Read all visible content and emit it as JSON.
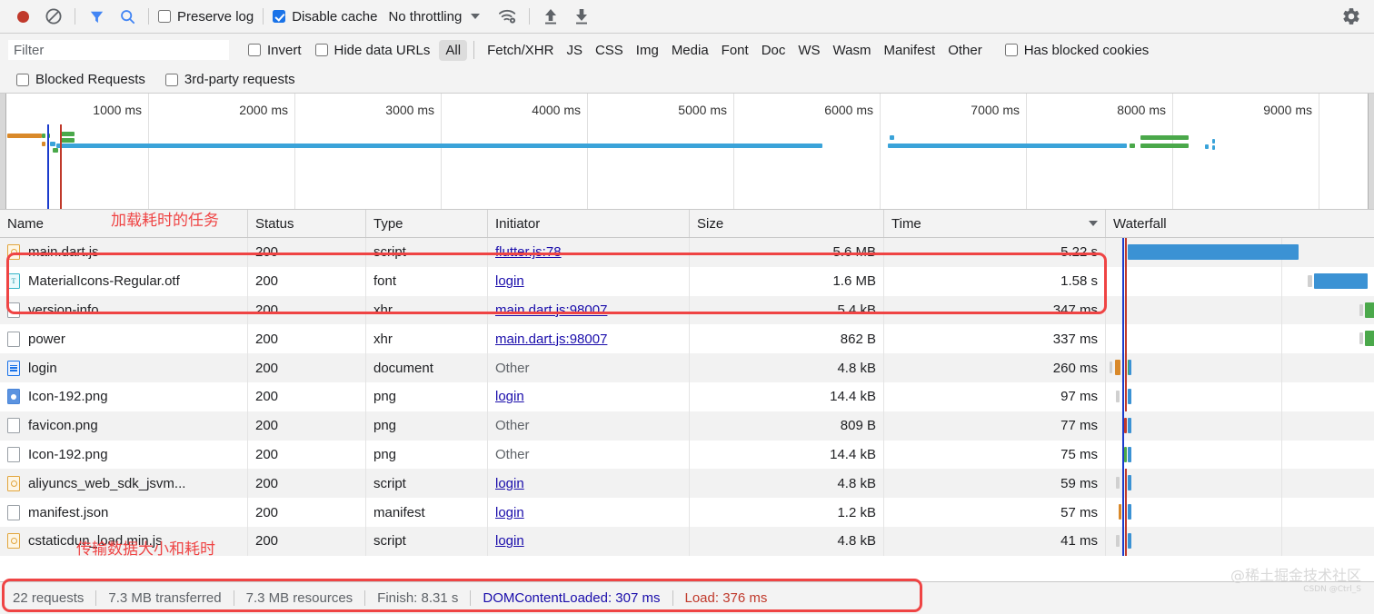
{
  "toolbar": {
    "record_button": "record",
    "clear_button": "clear",
    "filter_icon": "filter-funnel-icon",
    "search_icon": "search-icon",
    "preserve_log_label": "Preserve log",
    "preserve_log_checked": false,
    "disable_cache_label": "Disable cache",
    "disable_cache_checked": true,
    "throttling_value": "No throttling",
    "network_conditions_icon": "wifi-settings-icon",
    "import_har_icon": "upload-arrow-icon",
    "export_har_icon": "download-arrow-icon",
    "settings_icon": "gear-icon"
  },
  "filterbar": {
    "filter_placeholder": "Filter",
    "filter_value": "",
    "invert_label": "Invert",
    "invert_checked": false,
    "hide_data_urls_label": "Hide data URLs",
    "hide_data_urls_checked": false,
    "types": [
      "All",
      "Fetch/XHR",
      "JS",
      "CSS",
      "Img",
      "Media",
      "Font",
      "Doc",
      "WS",
      "Wasm",
      "Manifest",
      "Other"
    ],
    "selected_type": "All",
    "has_blocked_cookies_label": "Has blocked cookies",
    "has_blocked_cookies_checked": false,
    "blocked_requests_label": "Blocked Requests",
    "blocked_requests_checked": false,
    "third_party_label": "3rd-party requests",
    "third_party_checked": false
  },
  "overview": {
    "ticks": [
      "1000 ms",
      "2000 ms",
      "3000 ms",
      "4000 ms",
      "5000 ms",
      "6000 ms",
      "7000 ms",
      "8000 ms",
      "9000 ms"
    ],
    "dcl_marker_color": "#1a3bcc",
    "load_marker_color": "#c0392b"
  },
  "table": {
    "columns": [
      "Name",
      "Status",
      "Type",
      "Initiator",
      "Size",
      "Time",
      "Waterfall"
    ],
    "sorted_column": "Time",
    "sort_direction": "descending",
    "rows": [
      {
        "icon": "script-file-icon",
        "name": "main.dart.js",
        "status": "200",
        "type": "script",
        "initiator": "flutter.js:78",
        "initiator_link": true,
        "size": "5.6 MB",
        "time": "5.22 s"
      },
      {
        "icon": "font-file-icon",
        "name": "MaterialIcons-Regular.otf",
        "status": "200",
        "type": "font",
        "initiator": "login",
        "initiator_link": true,
        "size": "1.6 MB",
        "time": "1.58 s"
      },
      {
        "icon": "generic-file-icon",
        "name": "version-info",
        "status": "200",
        "type": "xhr",
        "initiator": "main.dart.js:98007",
        "initiator_link": true,
        "size": "5.4 kB",
        "time": "347 ms"
      },
      {
        "icon": "generic-file-icon",
        "name": "power",
        "status": "200",
        "type": "xhr",
        "initiator": "main.dart.js:98007",
        "initiator_link": true,
        "size": "862 B",
        "time": "337 ms"
      },
      {
        "icon": "document-file-icon",
        "name": "login",
        "status": "200",
        "type": "document",
        "initiator": "Other",
        "initiator_link": false,
        "size": "4.8 kB",
        "time": "260 ms"
      },
      {
        "icon": "image-file-icon",
        "name": "Icon-192.png",
        "status": "200",
        "type": "png",
        "initiator": "login",
        "initiator_link": true,
        "size": "14.4 kB",
        "time": "97 ms"
      },
      {
        "icon": "generic-file-icon",
        "name": "favicon.png",
        "status": "200",
        "type": "png",
        "initiator": "Other",
        "initiator_link": false,
        "size": "809 B",
        "time": "77 ms"
      },
      {
        "icon": "generic-file-icon",
        "name": "Icon-192.png",
        "status": "200",
        "type": "png",
        "initiator": "Other",
        "initiator_link": false,
        "size": "14.4 kB",
        "time": "75 ms"
      },
      {
        "icon": "script-file-icon",
        "name": "aliyuncs_web_sdk_jsvm...",
        "status": "200",
        "type": "script",
        "initiator": "login",
        "initiator_link": true,
        "size": "4.8 kB",
        "time": "59 ms"
      },
      {
        "icon": "generic-file-icon",
        "name": "manifest.json",
        "status": "200",
        "type": "manifest",
        "initiator": "login",
        "initiator_link": true,
        "size": "1.2 kB",
        "time": "57 ms"
      },
      {
        "icon": "script-file-icon",
        "name": "cstaticdun_load.min.js",
        "status": "200",
        "type": "script",
        "initiator": "login",
        "initiator_link": true,
        "size": "4.8 kB",
        "time": "41 ms"
      }
    ]
  },
  "footer": {
    "requests": "22 requests",
    "transferred": "7.3 MB transferred",
    "resources": "7.3 MB resources",
    "finish": "Finish: 8.31 s",
    "dom_content_loaded": "DOMContentLoaded: 307 ms",
    "load": "Load: 376 ms"
  },
  "annotations": {
    "top_note": "加载耗时的任务",
    "bottom_note": "传输数据大小和耗时",
    "highlight_color": "#ef4444"
  },
  "watermark": {
    "text": "@稀土掘金技术社区",
    "sub": "CSDN @Ctrl_S"
  }
}
